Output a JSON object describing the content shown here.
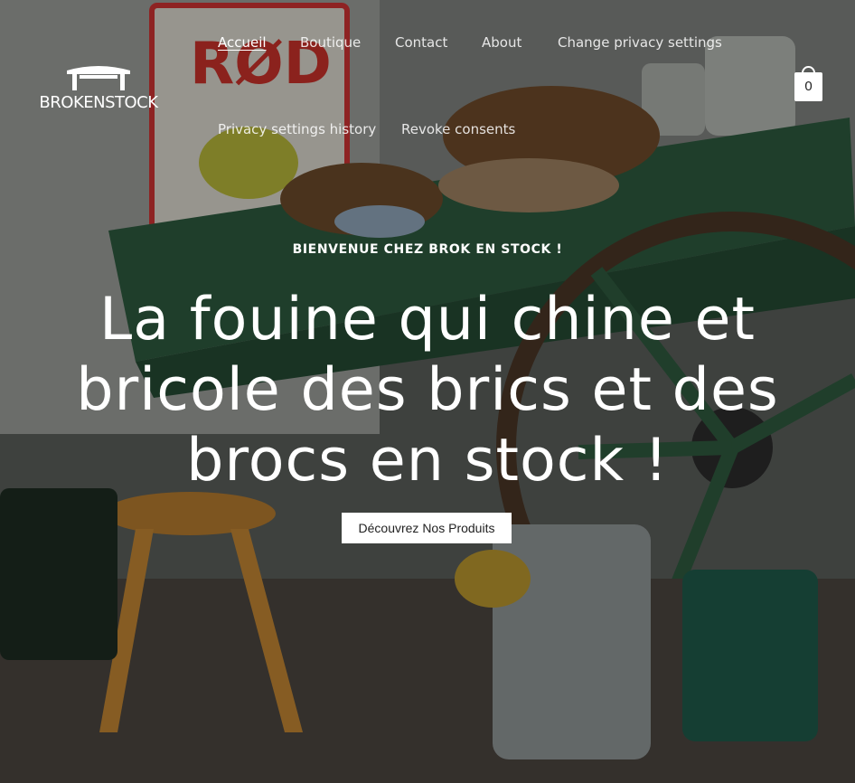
{
  "brand": {
    "name": "BROKENSTOCK",
    "logo_icon": "table-icon"
  },
  "nav": {
    "items": [
      {
        "label": "Accueil",
        "active": true
      },
      {
        "label": "Boutique"
      },
      {
        "label": "Contact"
      },
      {
        "label": "About"
      },
      {
        "label": "Change privacy settings"
      },
      {
        "label": "Privacy settings history"
      },
      {
        "label": "Revoke consents"
      }
    ]
  },
  "cart": {
    "count": "0",
    "icon": "shopping-bag-icon"
  },
  "hero": {
    "kicker": "BIENVENUE CHEZ BROK EN STOCK !",
    "headline": "La fouine qui chine et bricole des brics et des brocs en stock !",
    "cta_label": "Découvrez Nos Produits"
  },
  "colors": {
    "overlay": "rgba(0,0,0,0.30)",
    "text": "#ffffff",
    "button_bg": "#ffffff",
    "button_text": "#222222"
  }
}
